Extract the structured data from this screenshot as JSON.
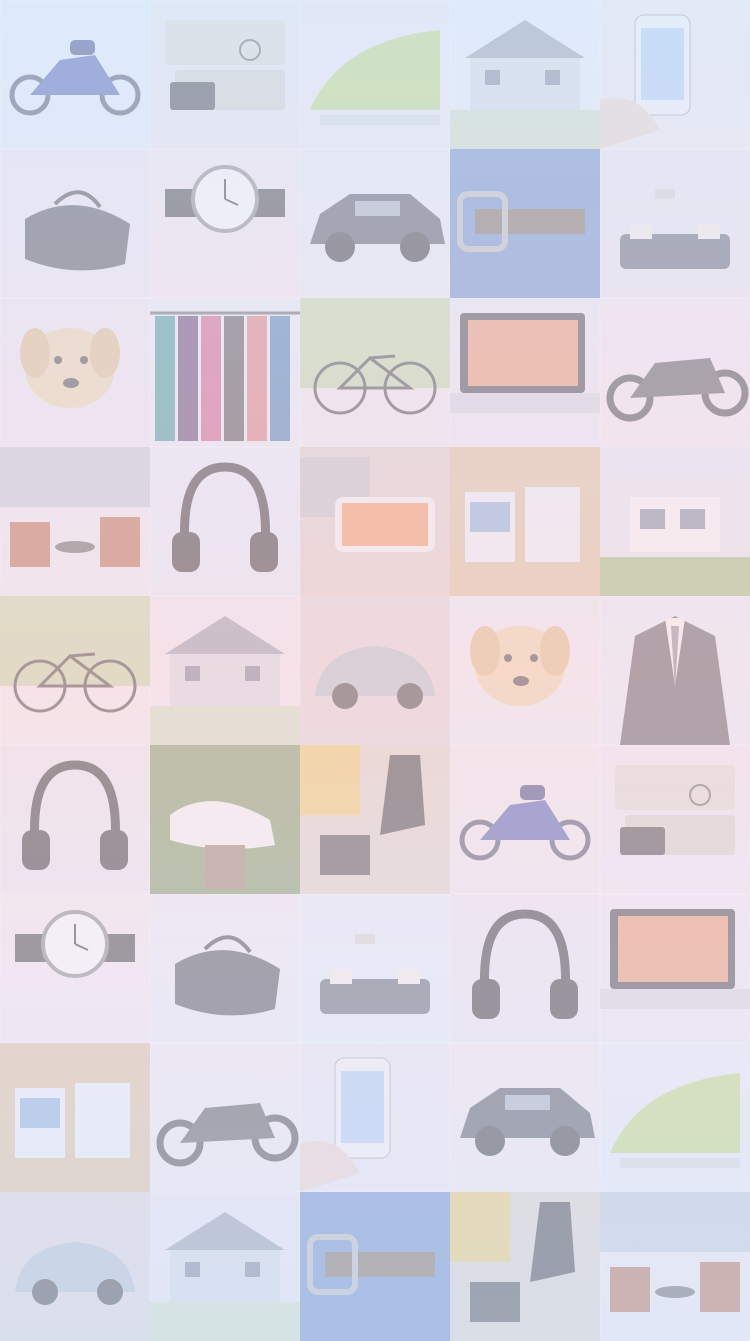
{
  "background": {
    "columns": 5,
    "tiles": [
      "motorcycle",
      "books-glasses",
      "steam-iron",
      "house",
      "smartphone-hand",
      "duffel-bag",
      "wristwatch",
      "car",
      "belt-buckle",
      "sofa-room",
      "dog",
      "clothes-rack",
      "bicycle",
      "laptop",
      "motorcycle-cafe",
      "patio-chairs",
      "headphones",
      "phone-keyboard",
      "bedroom",
      "modern-house",
      "bicycle",
      "house",
      "vw-beetle",
      "dog",
      "suit",
      "headphones",
      "sneakers",
      "boots",
      "motorcycle",
      "books-glasses",
      "wristwatch",
      "duffel-bag",
      "sofa-room",
      "headphones",
      "laptop",
      "bedroom",
      "motorcycle-cafe",
      "smartphone-hand",
      "car",
      "steam-iron",
      "vw-beetle",
      "house",
      "belt-buckle",
      "boots",
      "patio-chairs"
    ],
    "colors": {
      "top_tint": "#cfe4fb",
      "middle_tint": "#f6d6da",
      "bottom_tint": "#d2e2f8"
    }
  }
}
